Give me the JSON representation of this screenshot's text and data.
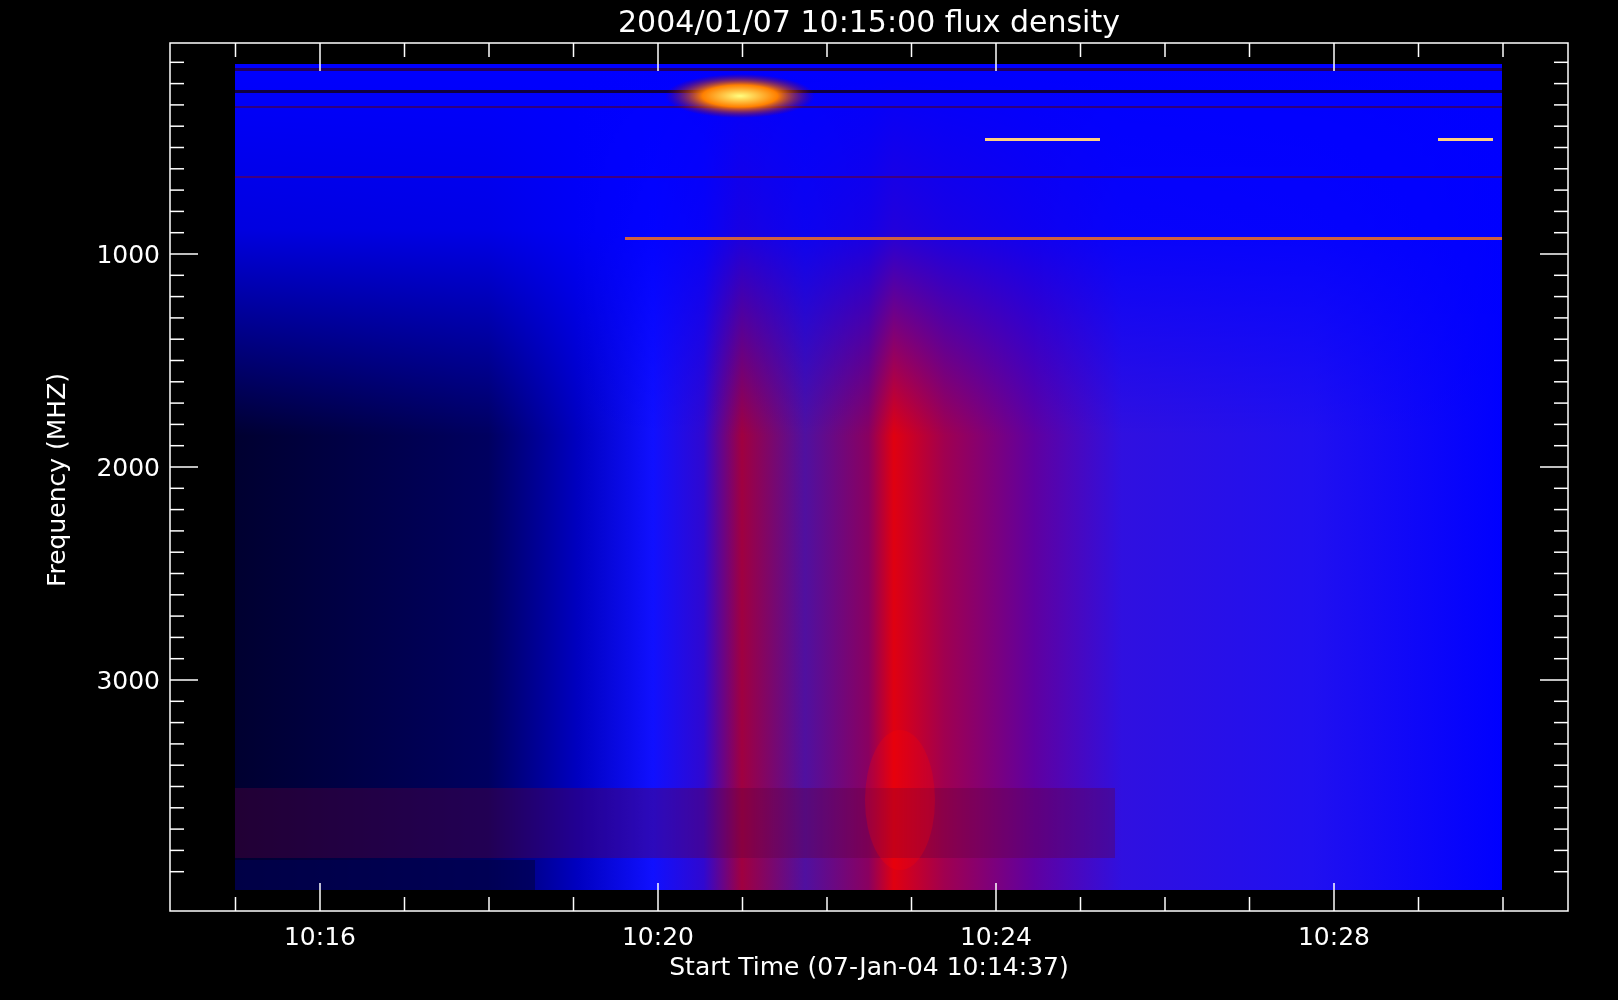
{
  "title": "2004/01/07 10:15:00 flux density",
  "y_axis": {
    "label": "Frequency (MHZ)",
    "ticks": [
      "1000",
      "2000",
      "3000"
    ]
  },
  "x_axis": {
    "label": "Start Time (07-Jan-04 10:14:37)",
    "ticks": [
      "10:16",
      "10:20",
      "10:24",
      "10:28"
    ]
  }
}
